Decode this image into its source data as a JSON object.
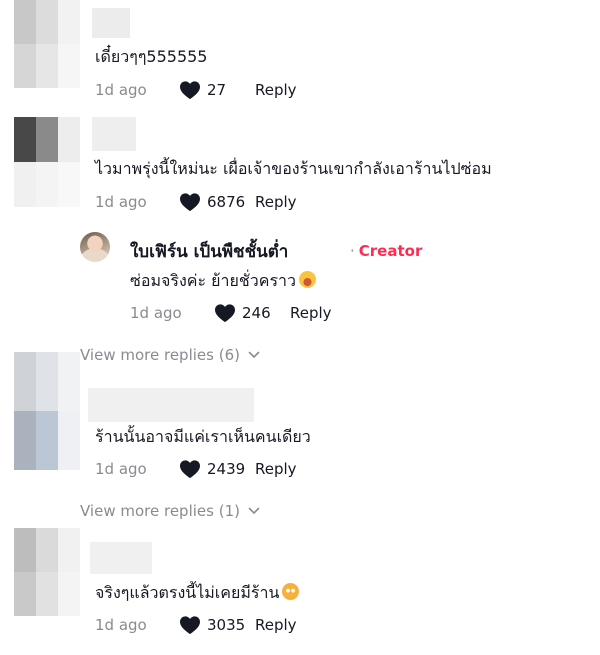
{
  "comments": [
    {
      "text": "เดี๋ยวๆๆ555555",
      "date": "1d ago",
      "likes": "27",
      "reply_label": "Reply",
      "avatar_colors": [
        "#c8c8c8",
        "#dcdcdc",
        "#f2f2f2",
        "#d6d6d6",
        "#e6e6e6",
        "#f6f6f6"
      ]
    },
    {
      "text": "ไวมาพรุ่งนี้ใหม่นะ เผื่อเจ้าของร้านเขากำลังเอาร้านไปซ่อม",
      "date": "1d ago",
      "likes": "6876",
      "reply_label": "Reply",
      "avatar_colors": [
        "#484848",
        "#8a8a8a",
        "#ededed",
        "#f0f0f0",
        "#f4f4f4",
        "#f8f8f8"
      ]
    },
    {
      "text": "ร้านนั้นอาจมีแค่เราเห็นคนเดียว",
      "date": "1d ago",
      "likes": "2439",
      "reply_label": "Reply",
      "avatar_colors": [
        "#cfd3d8",
        "#dfe3e8",
        "#f1f2f4",
        "#a9b2bd",
        "#bcc7d6",
        "#eef0f3"
      ]
    },
    {
      "text": "จริงๆแล้วตรงนี้ไม่เคยมีร้าน",
      "date": "1d ago",
      "likes": "3035",
      "reply_label": "Reply",
      "avatar_colors": [
        "#bdbdbd",
        "#dadada",
        "#f1f1f1",
        "#c9c9c9",
        "#e1e1e1",
        "#f4f4f4"
      ]
    }
  ],
  "creator_reply": {
    "name": "ใบเฟิร์น เป็นพืชชั้นต่ำ",
    "badge": "Creator",
    "text": "ซ่อมจริงค่ะ ย้ายชั่วคราว",
    "date": "1d ago",
    "likes": "246",
    "reply_label": "Reply"
  },
  "view_more": [
    "View more replies (6)",
    "View more replies (1)"
  ],
  "colors": {
    "accent": "#fe2c55",
    "muted": "#8a8b91",
    "text": "#161823"
  }
}
